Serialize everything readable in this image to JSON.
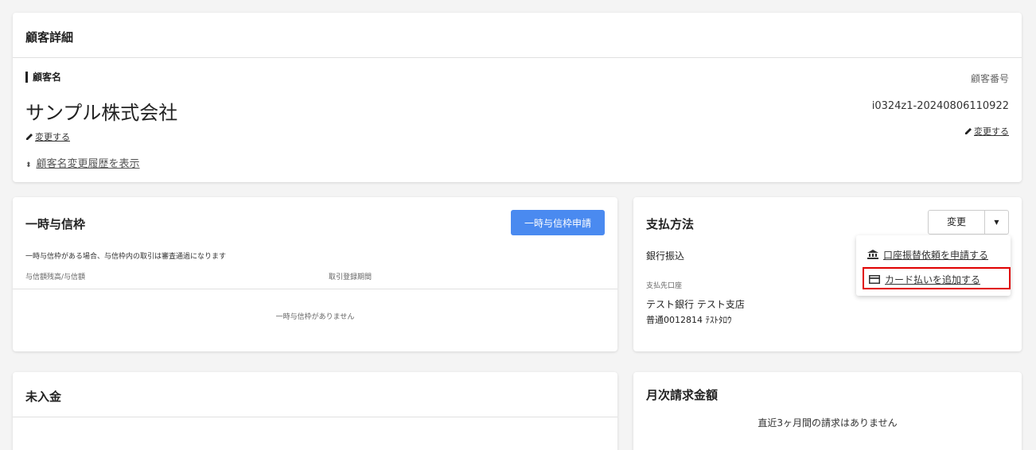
{
  "customer": {
    "title": "顧客詳細",
    "name_label": "顧客名",
    "name": "サンプル株式会社",
    "change_name": "変更する",
    "number_label": "顧客番号",
    "number": "i0324z1-20240806110922",
    "change_number": "変更する",
    "history_link": "顧客名変更履歴を表示"
  },
  "temp_credit": {
    "title": "一時与信枠",
    "apply_button": "一時与信枠申請",
    "note": "一時与信枠がある場合、与信枠内の取引は審査通過になります",
    "col_balance": "与信額残高/与信額",
    "col_period": "取引登録期間",
    "empty": "一時与信枠がありません"
  },
  "payment": {
    "title": "支払方法",
    "change_button": "変更",
    "method": "銀行振込",
    "account_label": "支払先口座",
    "bank": "テスト銀行 テスト支店",
    "account": "普通0012814 ﾃｽﾄﾀﾛｳ",
    "menu": [
      {
        "label": "口座振替依頼を申請する",
        "icon": "bank-icon"
      },
      {
        "label": "カード払いを追加する",
        "icon": "credit-card-icon"
      }
    ],
    "highlight_color": "#e00000"
  },
  "unpaid": {
    "title": "未入金"
  },
  "monthly": {
    "title": "月次請求金額",
    "empty": "直近3ヶ月間の請求はありません"
  },
  "colors": {
    "primary": "#4a8af0"
  }
}
